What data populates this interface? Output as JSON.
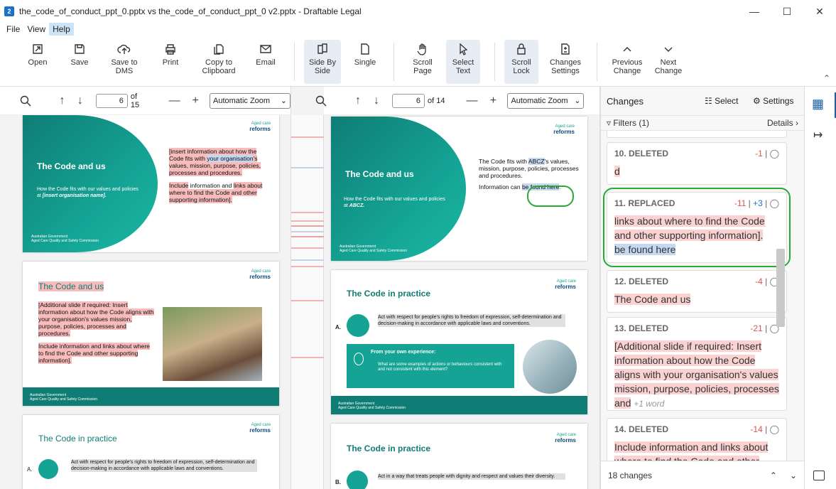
{
  "window": {
    "title": "the_code_of_conduct_ppt_0.pptx vs the_code_of_conduct_ppt_0 v2.pptx - Draftable Legal",
    "app_icon": "2"
  },
  "menu": [
    "File",
    "View",
    "Help"
  ],
  "ribbon": {
    "buttons": [
      {
        "label": "Open",
        "icon": "open-icon"
      },
      {
        "label": "Save",
        "icon": "save-icon"
      },
      {
        "label": "Save to\nDMS",
        "icon": "cloud-upload-icon"
      },
      {
        "label": "Print",
        "icon": "print-icon"
      },
      {
        "label": "Copy to\nClipboard",
        "icon": "copy-icon"
      },
      {
        "label": "Email",
        "icon": "email-icon"
      },
      {
        "label": "Side By\nSide",
        "icon": "side-by-side-icon"
      },
      {
        "label": "Single",
        "icon": "single-page-icon"
      },
      {
        "label": "Scroll\nPage",
        "icon": "hand-icon"
      },
      {
        "label": "Select\nText",
        "icon": "cursor-icon"
      },
      {
        "label": "Scroll\nLock",
        "icon": "lock-icon"
      },
      {
        "label": "Changes\nSettings",
        "icon": "changes-settings-icon"
      },
      {
        "label": "Previous\nChange",
        "icon": "chevron-up-icon"
      },
      {
        "label": "Next\nChange",
        "icon": "chevron-down-icon"
      }
    ]
  },
  "left_pane": {
    "page": "6",
    "of": "of 15",
    "zoom": "Automatic Zoom"
  },
  "right_pane": {
    "page": "6",
    "of": "of 14",
    "zoom": "Automatic Zoom"
  },
  "slides_left": {
    "s1": {
      "title": "The Code and us",
      "subtitle": "How the Code fits with our values and policies at ",
      "subtitle_italic": "[insert organisation name].",
      "para1_a": "[insert information about how the Code fits with ",
      "para1_b": "your organisation",
      "para1_c": "'s values, mission, purpose, policies, processes and procedures.",
      "para2_a": "Include",
      "para2_b": " information and ",
      "para2_c": "links about where to find the Code and other supporting information]."
    },
    "s2": {
      "title": "The Code and us",
      "body1": "[Additional slide if required: Insert information about how the Code aligns with your organisation's values mission, purpose, policies, processes and procedures.",
      "body2": "Include information and links about where to find the Code and other supporting information]."
    },
    "s3": {
      "title": "The Code in practice",
      "letter": "A.",
      "text": "Act with respect for people's rights to freedom of expression, self-determination and decision-making in accordance with applicable laws and conventions."
    }
  },
  "slides_right": {
    "s1": {
      "title": "The Code and us",
      "subtitle": "How the Code fits with our values and policies at ",
      "subtitle_italic": "ABCZ.",
      "para1_a": "The Code fits with ",
      "para1_b": "ABCZ",
      "para1_c": "'s values, mission, purpose, policies, processes and procedures.",
      "para2_a": "Information can ",
      "para2_b": "be found here",
      "para2_c": "."
    },
    "s2": {
      "title": "The Code in practice",
      "letter": "A.",
      "text": "Act with respect for people's rights to freedom of expression, self-determination and decision-making in accordance with applicable laws and conventions.",
      "exp_title": "From your own experience:",
      "exp_q": "What are some examples of actions or behaviours consistent with and not consistent with this element?"
    },
    "s3": {
      "title": "The Code in practice",
      "letter": "B.",
      "text": "Act in a way that treats people with dignity and respect and values their diversity."
    }
  },
  "logo": {
    "line1": "Aged care",
    "line2": "reforms"
  },
  "gov": {
    "line1": "Australian Government",
    "line2": "Aged Care Quality and Safety Commission"
  },
  "changes": {
    "title": "Changes",
    "select": "Select",
    "settings": "Settings",
    "filters": "Filters (1)",
    "details": "Details",
    "cards": [
      {
        "head": "10. DELETED",
        "count": "-1",
        "text": "d"
      },
      {
        "head": "11. REPLACED",
        "count_del": "-11",
        "count_add": "+3",
        "text_del": "links about where to find the Code and other supporting information].",
        "text_add": "be found here"
      },
      {
        "head": "12. DELETED",
        "count": "-4",
        "text": "The Code and us"
      },
      {
        "head": "13. DELETED",
        "count": "-21",
        "text": "[Additional slide if required: Insert information about how the Code aligns with your organisation's values mission, purpose, policies, processes and",
        "extra": "+1 word"
      },
      {
        "head": "14. DELETED",
        "count": "-14",
        "text": "Include information and links about where to find the Code and other"
      }
    ],
    "footer": "18 changes"
  }
}
